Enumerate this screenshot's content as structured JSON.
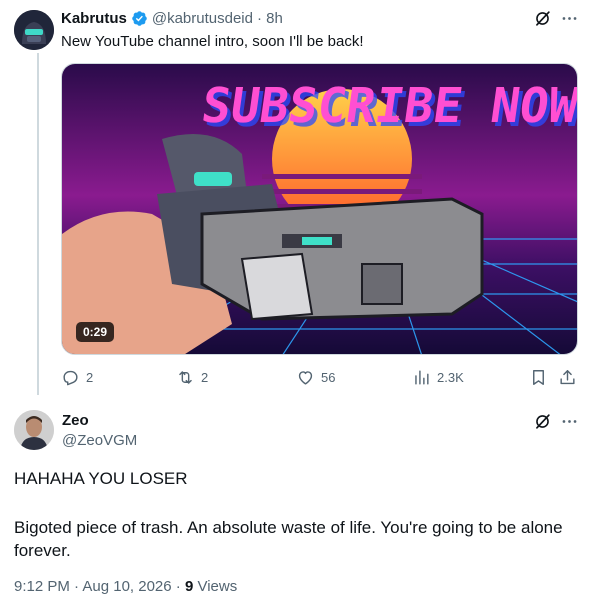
{
  "tweet": {
    "author_name": "Kabrutus",
    "verified": true,
    "handle": "@kabrutusdeid",
    "time": "· 8h",
    "text": "New YouTube channel intro, soon I'll be back!",
    "media": {
      "duration": "0:29",
      "overlay_text": "SUBSCRIBE NOW!!?"
    },
    "actions": {
      "replies": "2",
      "reposts": "2",
      "likes": "56",
      "views": "2.3K"
    }
  },
  "reply": {
    "author_name": "Zeo",
    "handle": "@ZeoVGM",
    "body_line1": "HAHAHA YOU LOSER",
    "body_line2": "Bigoted piece of trash. An absolute waste of life. You're going to be alone forever.",
    "timestamp": "9:12 PM · Aug 10, 2026 · ",
    "views_count": "9",
    "views_label": " Views"
  },
  "colors": {
    "text": "#0f1419",
    "muted": "#536471",
    "verified": "#1d9bf0",
    "border": "#cfd9de"
  },
  "icons": [
    "verified-badge-icon",
    "grok-icon",
    "more-icon",
    "reply-icon",
    "repost-icon",
    "like-icon",
    "views-icon",
    "bookmark-icon",
    "share-icon"
  ]
}
